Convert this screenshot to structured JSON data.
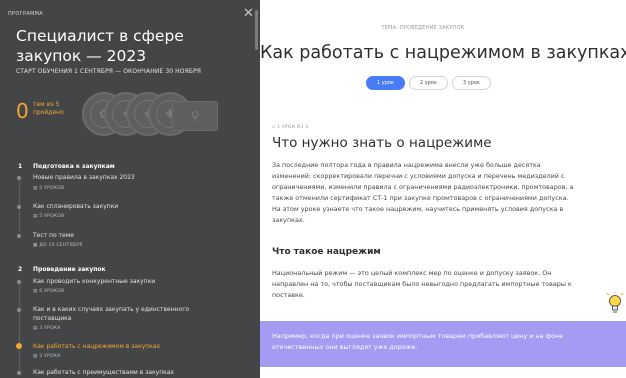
{
  "sidebar": {
    "label": "ПРОГРАММА",
    "title": "Специалист в сфере закупок — 2023",
    "dates": "СТАРТ ОБУЧЕНИЯ 1 СЕНТЯБРЯ — ОКОНЧАНИЕ 30 НОЯБРЯ",
    "progress_num": "0",
    "progress_text": "тем из 5 пройдено",
    "sections": [
      {
        "num": "1",
        "title": "Подготовка к закупкам",
        "items": [
          {
            "label": "Новые правила в закупках 2023",
            "meta": "5 УРОКОВ"
          },
          {
            "label": "Как спланировать закупки",
            "meta": "5 УРОКОВ"
          },
          {
            "label": "Тест по теме",
            "meta": "ДО 10 СЕНТЯБРЯ"
          }
        ]
      },
      {
        "num": "2",
        "title": "Проведение закупок",
        "items": [
          {
            "label": "Как проводить конкурентные закупки",
            "meta": "6 УРОКОВ"
          },
          {
            "label": "Как и в каких случаях закупать у единственного поставщика",
            "meta": "3 УРОКА"
          },
          {
            "label": "Как работать с нацрежимом в закупках",
            "meta": "3 УРОКА"
          },
          {
            "label": "Как работать с преимуществами в закупках",
            "meta": ""
          }
        ]
      }
    ]
  },
  "main": {
    "topic": "ТЕМА: ПРОВЕДЕНИЕ ЗАКУПОК",
    "title": "Как работать с нацрежимом в закупках",
    "tabs": [
      "1 урок",
      "2 урок",
      "3 урок"
    ],
    "step_label": "1 УРОК ИЗ 3",
    "heading": "Что нужно знать о нацрежиме",
    "paragraph1": "За последние полтора года в правила нацрежима внесли уже больше десятка изменений: скорректировали перечни с условиями допуска и перечень медизделий с ограничениями, изменили правила с ограничениями радиоэлектроники, промтоваров, а также отменили сертификат СТ-1 при закупке промтоваров с ограничениями допуска. На этом уроке узнаете что такое нацрежим, научитесь применять условия допуска в закупках.",
    "subheading": "Что такое нацрежим",
    "paragraph2": "Национальный режим — это целый комплекс мер по оценке и допуску заявок. Он направлен на то, чтобы поставщикам было невыгодно предлагать импортные товары к поставке.",
    "callout": "Например, когда при оценке заявок импортным товарам прибавляют цену и на фоне отечественных они выглядят уже дороже."
  },
  "colors": {
    "sidebar_bg": "#434547",
    "accent": "#f5a630",
    "tab_active": "#4a7bf7",
    "callout_bg": "#a59bf2"
  },
  "icons": {
    "close": "close-icon",
    "calendar": "calendar-icon",
    "lightbulb": "lightbulb-icon",
    "badge": "award-badge-icon",
    "certificate": "certificate-icon"
  }
}
